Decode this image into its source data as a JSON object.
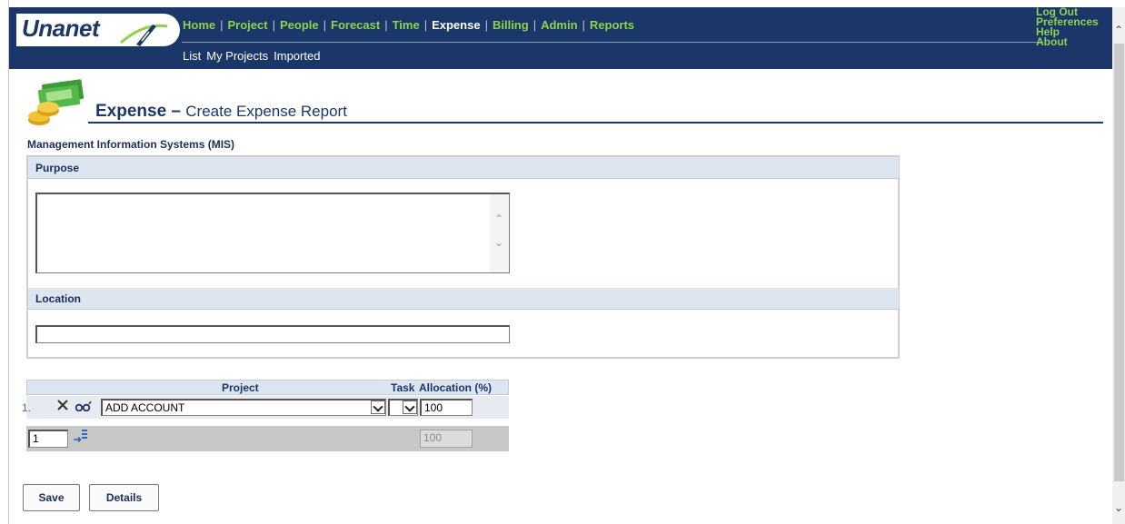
{
  "app": {
    "logo_text": "Unanet"
  },
  "nav": {
    "main": [
      {
        "label": "Home",
        "active": false
      },
      {
        "label": "Project",
        "active": false
      },
      {
        "label": "People",
        "active": false
      },
      {
        "label": "Forecast",
        "active": false
      },
      {
        "label": "Time",
        "active": false
      },
      {
        "label": "Expense",
        "active": true
      },
      {
        "label": "Billing",
        "active": false
      },
      {
        "label": "Admin",
        "active": false
      },
      {
        "label": "Reports",
        "active": false
      }
    ],
    "sub": [
      "List",
      "My Projects",
      "Imported"
    ],
    "right": [
      "Log Out",
      "Preferences",
      "Help",
      "About"
    ]
  },
  "page": {
    "title_main": "Expense",
    "title_dash": " – ",
    "title_sub": "Create Expense Report",
    "organization": "Management Information Systems (MIS)"
  },
  "form": {
    "purpose_label": "Purpose",
    "purpose_value": "",
    "location_label": "Location",
    "location_value": ""
  },
  "allocation": {
    "headers": {
      "project": "Project",
      "task": "Task",
      "allocation": "Allocation (%)"
    },
    "rows": [
      {
        "number": "1.",
        "project": "ADD ACCOUNT",
        "task": "",
        "allocation": "100"
      }
    ],
    "add_rows_value": "1",
    "total": "100"
  },
  "buttons": {
    "save": "Save",
    "details": "Details"
  },
  "colors": {
    "header_bg": "#1b3668",
    "nav_link": "#8fd14f",
    "section_bg": "#dde5f0"
  },
  "icons": [
    "logo-swoosh-icon",
    "expense-money-icon",
    "delete-x-icon",
    "lookup-binoculars-icon",
    "add-rows-icon"
  ]
}
